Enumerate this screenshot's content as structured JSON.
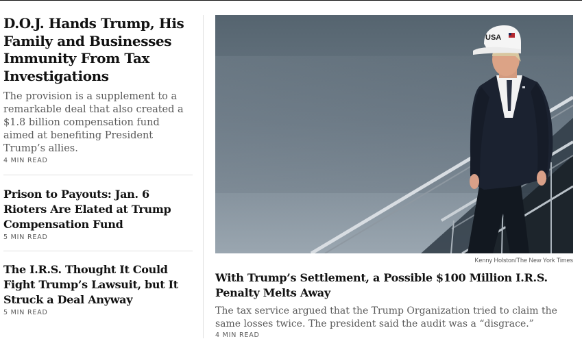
{
  "left_stories": [
    {
      "headline": "D.O.J. Hands Trump, His Family and Businesses Immunity From Tax Investigations",
      "summary": "The provision is a supplement to a remarkable deal that also created a $1.8 billion compensation fund aimed at benefiting President Trump’s allies.",
      "read_time": "4 MIN READ"
    },
    {
      "headline": "Prison to Payouts: Jan. 6 Rioters Are Elated at Trump Compensation Fund",
      "read_time": "5 MIN READ"
    },
    {
      "headline": "The I.R.S. Thought It Could Fight Trump’s Lawsuit, but It Struck a Deal Anyway",
      "read_time": "5 MIN READ"
    }
  ],
  "main_story": {
    "photo_credit": "Kenny Holston/The New York Times",
    "hat_text": "USA",
    "headline": "With Trump’s Settlement, a Possible $100 Million I.R.S. Penalty Melts Away",
    "summary": "The tax service argued that the Trump Organization tried to claim the same losses twice. The president said the audit was a “disgrace.”",
    "read_time": "4 MIN READ"
  }
}
